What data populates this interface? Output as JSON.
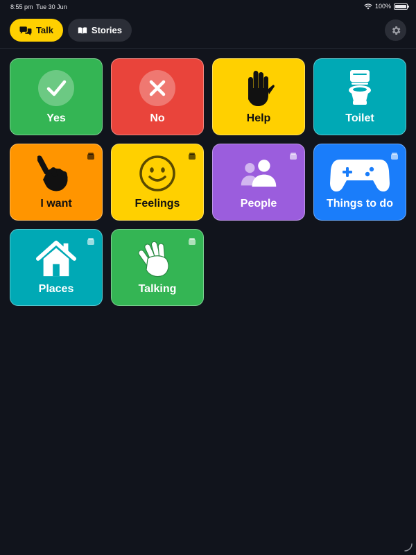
{
  "status": {
    "time": "8:55 pm",
    "date": "Tue 30 Jun",
    "battery": "100%",
    "battery_level": 1.0
  },
  "header": {
    "tabs": [
      {
        "label": "Talk",
        "selected": true,
        "icon": "speech-bubbles-icon"
      },
      {
        "label": "Stories",
        "selected": false,
        "icon": "open-book-icon"
      }
    ],
    "settings_icon": "gear-icon"
  },
  "tiles": [
    {
      "label": "Yes",
      "color": "#34b554",
      "icon": "checkmark-icon",
      "folder": false
    },
    {
      "label": "No",
      "color": "#e9443b",
      "icon": "cross-icon",
      "folder": false
    },
    {
      "label": "Help",
      "color": "#ffd000",
      "icon": "raised-hand-icon",
      "folder": false
    },
    {
      "label": "Toilet",
      "color": "#00a9b5",
      "icon": "toilet-icon",
      "folder": false
    },
    {
      "label": "I want",
      "color": "#ff9500",
      "icon": "pointing-hand-icon",
      "folder": true
    },
    {
      "label": "Feelings",
      "color": "#ffd000",
      "icon": "smiley-face-icon",
      "folder": true
    },
    {
      "label": "People",
      "color": "#9b5ddd",
      "icon": "people-icon",
      "folder": true
    },
    {
      "label": "Things to do",
      "color": "#1a7dfa",
      "icon": "game-controller-icon",
      "folder": true
    },
    {
      "label": "Places",
      "color": "#00a9b5",
      "icon": "house-icon",
      "folder": true
    },
    {
      "label": "Talking",
      "color": "#34b554",
      "icon": "waving-hand-icon",
      "folder": true
    }
  ]
}
